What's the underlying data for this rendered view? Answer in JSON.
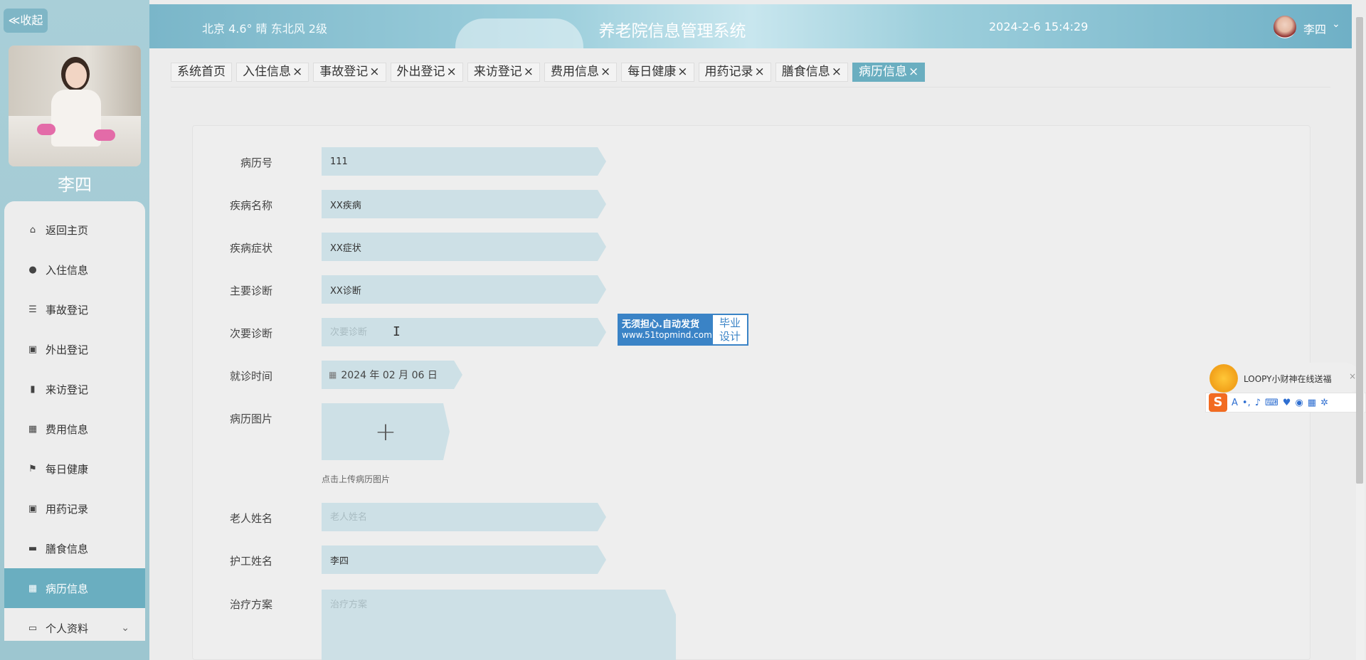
{
  "sidebar": {
    "collapse_label": "≪收起",
    "username": "李四",
    "menu": [
      {
        "label": "返回主页",
        "icon": "home-icon",
        "glyph": "⌂"
      },
      {
        "label": "入住信息",
        "icon": "user-icon",
        "glyph": "●"
      },
      {
        "label": "事故登记",
        "icon": "list-icon",
        "glyph": "☰"
      },
      {
        "label": "外出登记",
        "icon": "clipboard-icon",
        "glyph": "▣"
      },
      {
        "label": "来访登记",
        "icon": "bar-chart-icon",
        "glyph": "▮"
      },
      {
        "label": "费用信息",
        "icon": "grid-icon",
        "glyph": "▦"
      },
      {
        "label": "每日健康",
        "icon": "flag-icon",
        "glyph": "⚑"
      },
      {
        "label": "用药记录",
        "icon": "medicine-icon",
        "glyph": "▣"
      },
      {
        "label": "膳食信息",
        "icon": "food-icon",
        "glyph": "▬"
      },
      {
        "label": "病历信息",
        "icon": "grid-icon",
        "glyph": "▦",
        "active": true
      },
      {
        "label": "个人资料",
        "icon": "profile-icon",
        "glyph": "▭",
        "chevron": true
      }
    ]
  },
  "header": {
    "weather": "北京  4.6°  晴  东北风  2级",
    "title": "养老院信息管理系统",
    "datetime": "2024-2-6 15:4:29",
    "user_name": "李四"
  },
  "tabs": [
    {
      "label": "系统首页",
      "closable": false
    },
    {
      "label": "入住信息",
      "closable": true
    },
    {
      "label": "事故登记",
      "closable": true
    },
    {
      "label": "外出登记",
      "closable": true
    },
    {
      "label": "来访登记",
      "closable": true
    },
    {
      "label": "费用信息",
      "closable": true
    },
    {
      "label": "每日健康",
      "closable": true
    },
    {
      "label": "用药记录",
      "closable": true
    },
    {
      "label": "膳食信息",
      "closable": true
    },
    {
      "label": "病历信息",
      "closable": true,
      "active": true
    }
  ],
  "form": {
    "record_no": {
      "label": "病历号",
      "value": "111",
      "placeholder": ""
    },
    "disease_name": {
      "label": "疾病名称",
      "value": "XX疾病",
      "placeholder": ""
    },
    "symptoms": {
      "label": "疾病症状",
      "value": "XX症状",
      "placeholder": ""
    },
    "primary_diagnosis": {
      "label": "主要诊断",
      "value": "XX诊断",
      "placeholder": ""
    },
    "secondary_diagnosis": {
      "label": "次要诊断",
      "value": "",
      "placeholder": "次要诊断"
    },
    "visit_date": {
      "label": "就诊时间",
      "value": "2024 年 02 月 06 日"
    },
    "record_image": {
      "label": "病历图片",
      "hint": "点击上传病历图片"
    },
    "elder_name": {
      "label": "老人姓名",
      "value": "",
      "placeholder": "老人姓名"
    },
    "caregiver_name": {
      "label": "护工姓名",
      "value": "李四",
      "placeholder": ""
    },
    "treatment_plan": {
      "label": "治疗方案",
      "value": "",
      "placeholder": "治疗方案"
    }
  },
  "ad": {
    "line1": "无须担心.自动发货",
    "line2": "www.51topmind.com",
    "right1": "毕业",
    "right2": "设计"
  },
  "loopy": {
    "text": "LOOPY小财神在线送福",
    "close": "×"
  },
  "ime": {
    "logo": "S"
  }
}
